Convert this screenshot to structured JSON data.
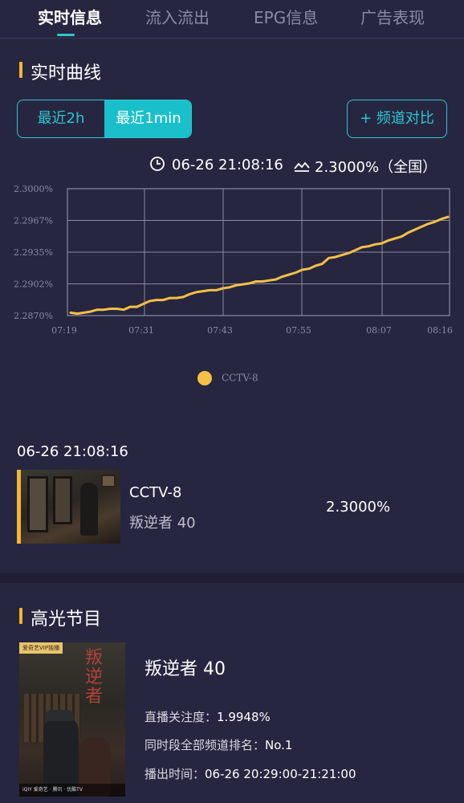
{
  "tabs": [
    "实时信息",
    "流入流出",
    "EPG信息",
    "广告表现"
  ],
  "realtime": {
    "section_title": "实时曲线",
    "range_2h": "最近2h",
    "range_1min": "最近1min",
    "compare_label": "+ 频道对比",
    "time_icon": "clock-icon",
    "timestamp": "06-26 21:08:16",
    "trend_icon": "trend-icon",
    "rating_text": "2.3000%（全国）"
  },
  "chart_data": {
    "type": "line",
    "xlabel": "",
    "ylabel": "",
    "x_ticks": [
      "07:19",
      "07:31",
      "07:43",
      "07:55",
      "08:07",
      "08:16"
    ],
    "y_ticks": [
      "2.3000%",
      "2.2967%",
      "2.2935%",
      "2.2902%",
      "2.2870%"
    ],
    "ylim": [
      2.287,
      2.3
    ],
    "grid": true,
    "legend_position": "bottom",
    "series": [
      {
        "name": "CCTV-8",
        "color": "#f4c046",
        "x": [
          0,
          1,
          2,
          3,
          4,
          5,
          6,
          7,
          8,
          9,
          10,
          11,
          12,
          13,
          14,
          15,
          16,
          17,
          18,
          19,
          20,
          21,
          22,
          23,
          24,
          25,
          26,
          27,
          28,
          29,
          30,
          31,
          32,
          33,
          34,
          35,
          36,
          37,
          38,
          39,
          40,
          41,
          42,
          43,
          44,
          45,
          46,
          47,
          48,
          49,
          50,
          51,
          52,
          53,
          54,
          55,
          56,
          57
        ],
        "values": [
          2.2873,
          2.2872,
          2.2873,
          2.2874,
          2.2876,
          2.2876,
          2.2877,
          2.2877,
          2.2876,
          2.2879,
          2.2879,
          2.2882,
          2.2885,
          2.2886,
          2.2886,
          2.2888,
          2.2888,
          2.2889,
          2.2892,
          2.2894,
          2.2895,
          2.2896,
          2.2896,
          2.2898,
          2.2899,
          2.2901,
          2.2902,
          2.2903,
          2.2905,
          2.2905,
          2.2906,
          2.2907,
          2.291,
          2.2912,
          2.2914,
          2.2917,
          2.2918,
          2.2921,
          2.2923,
          2.2929,
          2.293,
          2.2932,
          2.2934,
          2.2937,
          2.294,
          2.2941,
          2.2943,
          2.2944,
          2.2947,
          2.2949,
          2.2951,
          2.2955,
          2.2958,
          2.2961,
          2.2964,
          2.2966,
          2.2969,
          2.2971
        ]
      }
    ]
  },
  "current": {
    "timestamp": "06-26 21:08:16",
    "channel": "CCTV-8",
    "episode": "叛逆者 40",
    "rating": "2.3000%"
  },
  "highlight": {
    "section_title": "高光节目",
    "poster_badge": "爱奇艺VIP独播",
    "poster_title": "叛逆者",
    "poster_logos": "iQIY 爱奇艺 · 腾讯 · 优酷TV",
    "program_title": "叛逆者 40",
    "attention_label": "直播关注度：",
    "attention_value": "1.9948%",
    "rank_label": "同时段全部频道排名：",
    "rank_value": "No.1",
    "airtime_label": "播出时间：",
    "airtime_value": "06-26 20:29:00-21:21:00"
  }
}
